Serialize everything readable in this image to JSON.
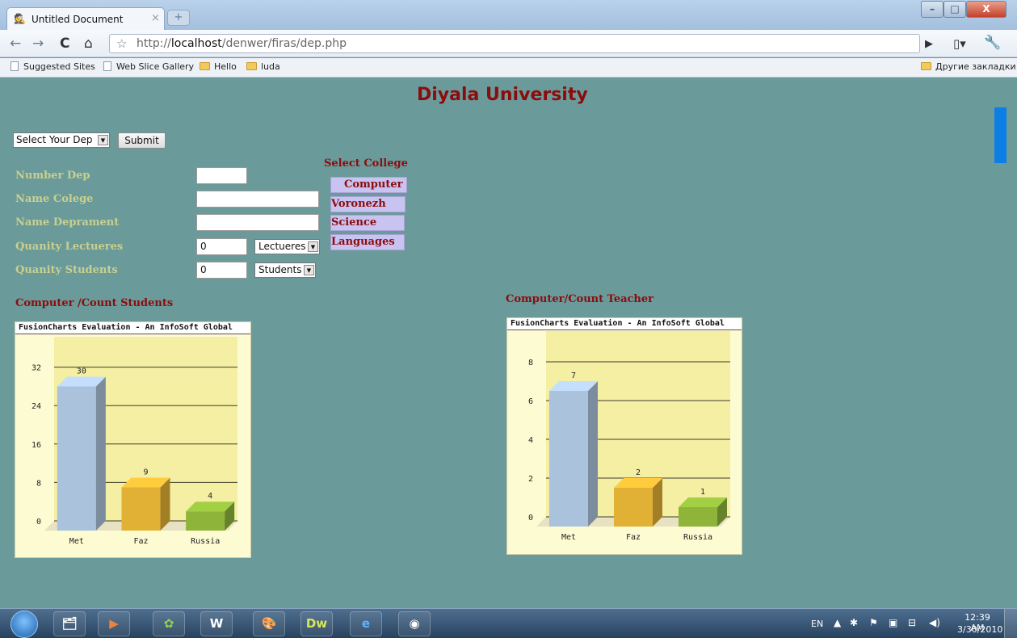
{
  "browser": {
    "tab_title": "Untitled Document",
    "tab_close": "×",
    "new_tab": "+",
    "url_prefix": "http://",
    "url_host": "localhost",
    "url_path": "/denwer/firas/dep.php",
    "bookmarks": [
      "Suggested Sites",
      "Web Slice Gallery",
      "Hello",
      "luda"
    ],
    "other_bookmarks": "Другие закладки",
    "window_buttons": {
      "minimize": "–",
      "maximize": "□",
      "close": "X"
    }
  },
  "page": {
    "title": "Diyala University",
    "dep_select": "Select Your Dep",
    "submit_label": "Submit",
    "form": {
      "number_dep_label": "Number Dep",
      "name_college_label": "Name Colege",
      "name_department_label": "Name Deprament",
      "quantity_lecturers_label": "Quanity Lectueres",
      "quantity_lecturers_value": "0",
      "lecturers_select": "Lectueres",
      "quantity_students_label": "Quanity Students",
      "quantity_students_value": "0",
      "students_select": "Students"
    },
    "college": {
      "title": "Select College",
      "items": [
        "Computer",
        "Voronezh",
        "Science",
        "Languages"
      ]
    },
    "charts": {
      "left_title": "Computer /Count Students",
      "right_title": "Computer/Count Teacher",
      "evaluation_banner": "FusionCharts Evaluation - An InfoSoft Global"
    }
  },
  "chart_data": [
    {
      "type": "bar",
      "categories": [
        "Met",
        "Faz",
        "Russia"
      ],
      "values": [
        30,
        9,
        4
      ],
      "ylim": [
        0,
        40
      ],
      "yticks": [
        0,
        8,
        16,
        24,
        32
      ],
      "grid": true,
      "colors": [
        "#aac2dc",
        "#e1b136",
        "#8eb43a"
      ]
    },
    {
      "type": "bar",
      "categories": [
        "Met",
        "Faz",
        "Russia"
      ],
      "values": [
        7,
        2,
        1
      ],
      "ylim": [
        0,
        10
      ],
      "yticks": [
        0,
        2,
        4,
        6,
        8
      ],
      "grid": true,
      "colors": [
        "#aac2dc",
        "#e1b136",
        "#8eb43a"
      ]
    }
  ],
  "taskbar": {
    "apps": [
      "explorer",
      "media-player",
      "flower-app",
      "W",
      "paint",
      "Dw",
      "internet-explorer",
      "chrome"
    ],
    "lang": "EN",
    "time": "12:39 AM",
    "date": "3/30/2010"
  }
}
